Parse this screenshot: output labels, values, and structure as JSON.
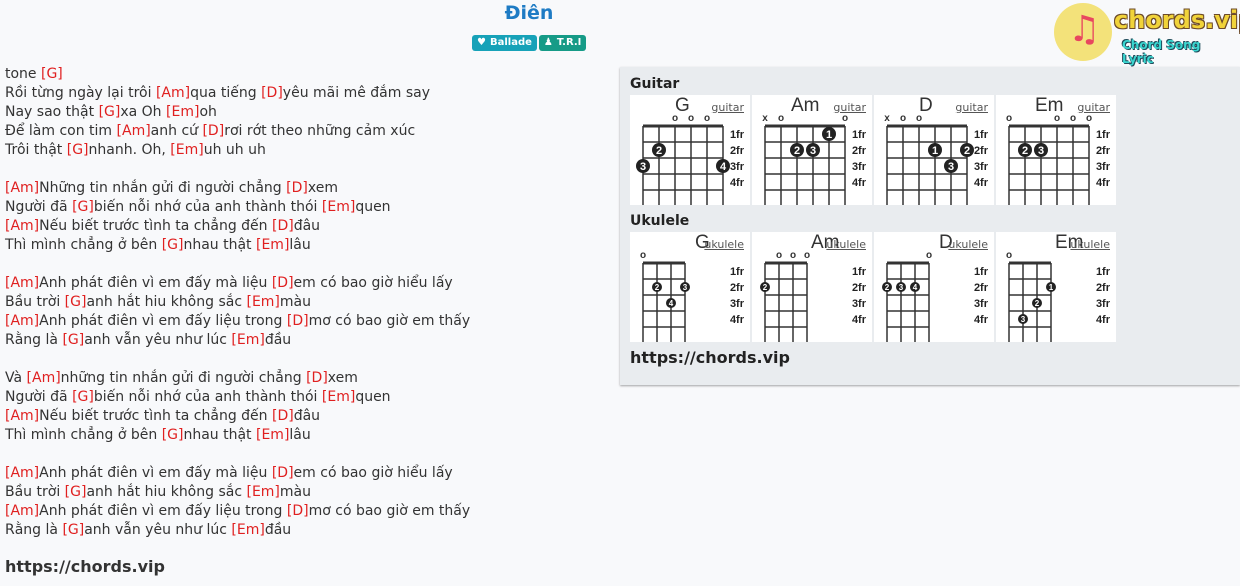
{
  "song": {
    "title": "Điên",
    "genre": "Ballade",
    "artist": "T.R.I"
  },
  "logo": {
    "name": "chords.vip",
    "tagline": "Chord Song Lyric"
  },
  "icons": {
    "genre": "heartbeat-icon",
    "artist": "user-icon",
    "logo": "guitar-icon"
  },
  "colors": {
    "chord": "#e02020",
    "title": "#1e7bc4",
    "genre_badge": "#17a2b8",
    "artist_badge": "#169b87"
  },
  "lyrics": [
    [
      {
        "t": "tone "
      },
      {
        "c": "[G]"
      }
    ],
    [
      {
        "t": "Rồi từng ngày lại trôi "
      },
      {
        "c": "[Am]"
      },
      {
        "t": "qua tiếng "
      },
      {
        "c": "[D]"
      },
      {
        "t": "yêu mãi mê đắm say"
      }
    ],
    [
      {
        "t": "Nay sao thật "
      },
      {
        "c": "[G]"
      },
      {
        "t": "xa Oh "
      },
      {
        "c": "[Em]"
      },
      {
        "t": "oh"
      }
    ],
    [
      {
        "t": "Để làm con tim "
      },
      {
        "c": "[Am]"
      },
      {
        "t": "anh cứ "
      },
      {
        "c": "[D]"
      },
      {
        "t": "rơi rớt theo những cảm xúc"
      }
    ],
    [
      {
        "t": "Trôi thật "
      },
      {
        "c": "[G]"
      },
      {
        "t": "nhanh. Oh, "
      },
      {
        "c": "[Em]"
      },
      {
        "t": "uh uh uh"
      }
    ],
    [],
    [
      {
        "c": "[Am]"
      },
      {
        "t": "Những tin nhắn gửi đi người chẳng "
      },
      {
        "c": "[D]"
      },
      {
        "t": "xem"
      }
    ],
    [
      {
        "t": "Người đã "
      },
      {
        "c": "[G]"
      },
      {
        "t": "biến nỗi nhớ của anh thành thói "
      },
      {
        "c": "[Em]"
      },
      {
        "t": "quen"
      }
    ],
    [
      {
        "c": "[Am]"
      },
      {
        "t": "Nếu biết trước tình ta chẳng đến "
      },
      {
        "c": "[D]"
      },
      {
        "t": "đâu"
      }
    ],
    [
      {
        "t": "Thì mình chẳng ở bên "
      },
      {
        "c": "[G]"
      },
      {
        "t": "nhau thật "
      },
      {
        "c": "[Em]"
      },
      {
        "t": "lâu"
      }
    ],
    [],
    [
      {
        "c": "[Am]"
      },
      {
        "t": "Anh phát điên vì em đấy mà liệu "
      },
      {
        "c": "[D]"
      },
      {
        "t": "em có bao giờ hiểu lấy"
      }
    ],
    [
      {
        "t": "Bầu trời "
      },
      {
        "c": "[G]"
      },
      {
        "t": "anh hắt hiu không sắc "
      },
      {
        "c": "[Em]"
      },
      {
        "t": "màu"
      }
    ],
    [
      {
        "c": "[Am]"
      },
      {
        "t": "Anh phát điên vì em đấy liệu trong "
      },
      {
        "c": "[D]"
      },
      {
        "t": "mơ có bao giờ em thấy"
      }
    ],
    [
      {
        "t": "Rằng là "
      },
      {
        "c": "[G]"
      },
      {
        "t": "anh vẫn yêu như lúc "
      },
      {
        "c": "[Em]"
      },
      {
        "t": "đầu"
      }
    ],
    [],
    [
      {
        "t": "Và "
      },
      {
        "c": "[Am]"
      },
      {
        "t": "những tin nhắn gửi đi người chẳng "
      },
      {
        "c": "[D]"
      },
      {
        "t": "xem"
      }
    ],
    [
      {
        "t": "Người đã "
      },
      {
        "c": "[G]"
      },
      {
        "t": "biến nỗi nhớ của anh thành thói "
      },
      {
        "c": "[Em]"
      },
      {
        "t": "quen"
      }
    ],
    [
      {
        "c": "[Am]"
      },
      {
        "t": "Nếu biết trước tình ta chẳng đến "
      },
      {
        "c": "[D]"
      },
      {
        "t": "đâu"
      }
    ],
    [
      {
        "t": "Thì mình chẳng ở bên "
      },
      {
        "c": "[G]"
      },
      {
        "t": "nhau thật "
      },
      {
        "c": "[Em]"
      },
      {
        "t": "lâu"
      }
    ],
    [],
    [
      {
        "c": "[Am]"
      },
      {
        "t": "Anh phát điên vì em đấy mà liệu "
      },
      {
        "c": "[D]"
      },
      {
        "t": "em có bao giờ hiểu lấy"
      }
    ],
    [
      {
        "t": "Bầu trời "
      },
      {
        "c": "[G]"
      },
      {
        "t": "anh hắt hiu không sắc "
      },
      {
        "c": "[Em]"
      },
      {
        "t": "màu"
      }
    ],
    [
      {
        "c": "[Am]"
      },
      {
        "t": "Anh phát điên vì em đấy liệu trong "
      },
      {
        "c": "[D]"
      },
      {
        "t": "mơ có bao giờ em thấy"
      }
    ],
    [
      {
        "t": "Rằng là "
      },
      {
        "c": "[G]"
      },
      {
        "t": "anh vẫn yêu như lúc "
      },
      {
        "c": "[Em]"
      },
      {
        "t": "đầu"
      }
    ]
  ],
  "footer_link": "https://chords.vip",
  "panel": {
    "guitar_label": "Guitar",
    "ukulele_label": "Ukulele",
    "link": "https://chords.vip",
    "fret_labels": [
      "1fr",
      "2fr",
      "3fr",
      "4fr"
    ],
    "guitar": [
      {
        "name": "G",
        "link": "guitar",
        "strings": [
          "",
          "",
          "o",
          "o",
          "o",
          ""
        ],
        "dots": [
          {
            "s": 1,
            "f": 2,
            "n": "2"
          },
          {
            "s": 0,
            "f": 3,
            "n": "3"
          },
          {
            "s": 5,
            "f": 3,
            "n": "4"
          }
        ]
      },
      {
        "name": "Am",
        "link": "guitar",
        "strings": [
          "x",
          "o",
          "",
          "",
          "",
          "o"
        ],
        "dots": [
          {
            "s": 4,
            "f": 1,
            "n": "1"
          },
          {
            "s": 2,
            "f": 2,
            "n": "2"
          },
          {
            "s": 3,
            "f": 2,
            "n": "3"
          }
        ]
      },
      {
        "name": "D",
        "link": "guitar",
        "strings": [
          "x",
          "o",
          "o",
          "",
          "",
          ""
        ],
        "dots": [
          {
            "s": 3,
            "f": 2,
            "n": "1"
          },
          {
            "s": 5,
            "f": 2,
            "n": "2"
          },
          {
            "s": 4,
            "f": 3,
            "n": "3"
          }
        ]
      },
      {
        "name": "Em",
        "link": "guitar",
        "strings": [
          "o",
          "",
          "",
          "o",
          "o",
          "o"
        ],
        "dots": [
          {
            "s": 1,
            "f": 2,
            "n": "2"
          },
          {
            "s": 2,
            "f": 2,
            "n": "3"
          }
        ]
      }
    ],
    "ukulele": [
      {
        "name": "G",
        "link": "ukulele",
        "strings": [
          "o",
          "",
          "",
          ""
        ],
        "dots": [
          {
            "s": 1,
            "f": 2,
            "n": "2"
          },
          {
            "s": 3,
            "f": 2,
            "n": "3"
          },
          {
            "s": 2,
            "f": 3,
            "n": "4"
          }
        ]
      },
      {
        "name": "Am",
        "link": "ukulele",
        "strings": [
          "",
          "o",
          "o",
          "o"
        ],
        "dots": [
          {
            "s": 0,
            "f": 2,
            "n": "2"
          }
        ]
      },
      {
        "name": "D",
        "link": "ukulele",
        "strings": [
          "",
          "",
          "",
          "o"
        ],
        "dots": [
          {
            "s": 0,
            "f": 2,
            "n": "2"
          },
          {
            "s": 1,
            "f": 2,
            "n": "3"
          },
          {
            "s": 2,
            "f": 2,
            "n": "4"
          }
        ]
      },
      {
        "name": "Em",
        "link": "ukulele",
        "strings": [
          "o",
          "",
          "",
          ""
        ],
        "dots": [
          {
            "s": 3,
            "f": 2,
            "n": "1"
          },
          {
            "s": 2,
            "f": 3,
            "n": "2"
          },
          {
            "s": 1,
            "f": 4,
            "n": "3"
          }
        ]
      }
    ]
  }
}
